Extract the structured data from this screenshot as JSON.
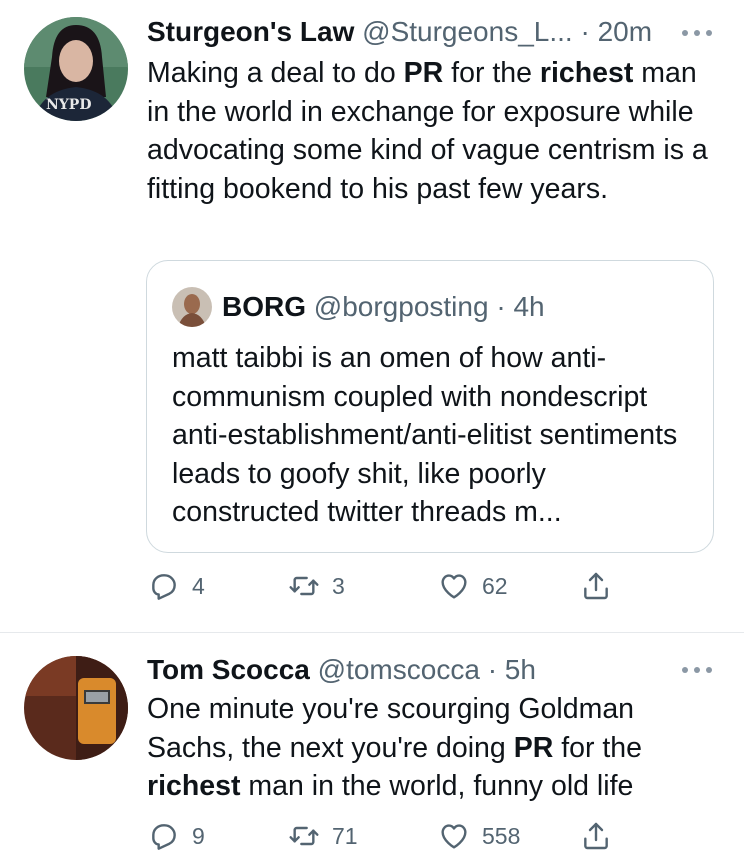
{
  "tweets": [
    {
      "author_name": "Sturgeon's Law",
      "handle": "@Sturgeons_L...",
      "separator": "·",
      "time": "20m",
      "avatar_text": "NYPD",
      "text_segments": [
        {
          "text": "Making a deal to do ",
          "bold": false
        },
        {
          "text": "PR",
          "bold": true
        },
        {
          "text": " for the ",
          "bold": false
        },
        {
          "text": "richest",
          "bold": true
        },
        {
          "text": " man in the world in exchange for exposure while advocating some kind of vague centrism is a fitting bookend to his past few years.",
          "bold": false
        }
      ],
      "quoted": {
        "author_name": "BORG",
        "handle": "@borgposting",
        "separator": "·",
        "time": "4h",
        "text": "matt taibbi is an omen of how anti-communism coupled with nondescript anti-establishment/anti-elitist sentiments leads to goofy shit, like poorly constructed twitter threads m..."
      },
      "replies": "4",
      "retweets": "3",
      "likes": "62"
    },
    {
      "author_name": "Tom Scocca",
      "handle": "@tomscocca",
      "separator": "·",
      "time": "5h",
      "text_segments": [
        {
          "text": "One minute you're scourging Goldman Sachs, the next you're doing ",
          "bold": false
        },
        {
          "text": "PR",
          "bold": true
        },
        {
          "text": " for the ",
          "bold": false
        },
        {
          "text": "richest",
          "bold": true
        },
        {
          "text": " man in the world, funny old life",
          "bold": false
        }
      ],
      "replies": "9",
      "retweets": "71",
      "likes": "558"
    }
  ],
  "icons": {
    "reply": "reply-icon",
    "retweet": "retweet-icon",
    "like": "heart-icon",
    "share": "share-icon",
    "more": "more-options-icon"
  },
  "colors": {
    "text": "#0f1419",
    "secondary": "#536471",
    "border": "#cfd9de",
    "divider": "#e6e9ec"
  }
}
